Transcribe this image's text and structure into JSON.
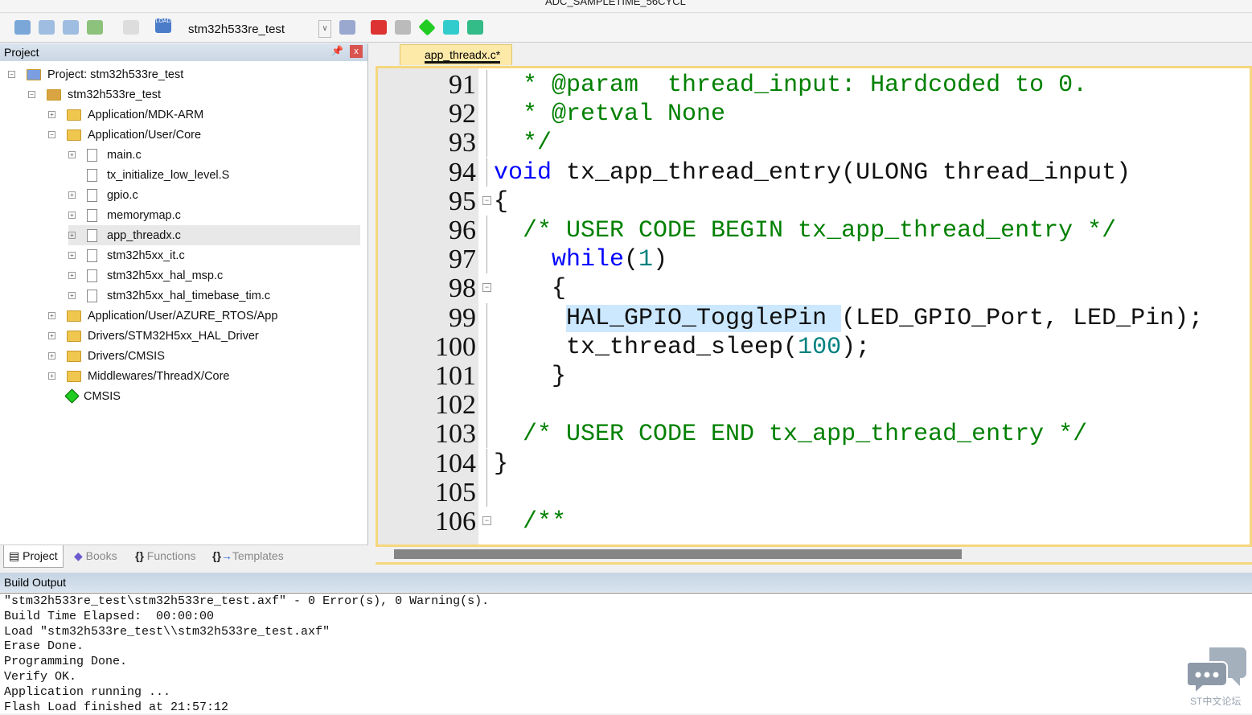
{
  "toolbar": {
    "target": "stm32h533re_test",
    "define_combo": "ADC_SAMPLETIME_56CYCL",
    "load_label": "LOAD"
  },
  "project_panel": {
    "title": "Project",
    "tree": [
      {
        "label": "Project: stm32h533re_test",
        "depth": 0,
        "kind": "project",
        "exp": "-"
      },
      {
        "label": "stm32h533re_test",
        "depth": 1,
        "kind": "target",
        "exp": "-"
      },
      {
        "label": "Application/MDK-ARM",
        "depth": 2,
        "kind": "folder",
        "exp": "+"
      },
      {
        "label": "Application/User/Core",
        "depth": 2,
        "kind": "folder",
        "exp": "-"
      },
      {
        "label": "main.c",
        "depth": 3,
        "kind": "file",
        "exp": "+"
      },
      {
        "label": "tx_initialize_low_level.S",
        "depth": 3,
        "kind": "file",
        "exp": ""
      },
      {
        "label": "gpio.c",
        "depth": 3,
        "kind": "file",
        "exp": "+"
      },
      {
        "label": "memorymap.c",
        "depth": 3,
        "kind": "file",
        "exp": "+"
      },
      {
        "label": "app_threadx.c",
        "depth": 3,
        "kind": "file",
        "exp": "+",
        "selected": true
      },
      {
        "label": "stm32h5xx_it.c",
        "depth": 3,
        "kind": "file",
        "exp": "+"
      },
      {
        "label": "stm32h5xx_hal_msp.c",
        "depth": 3,
        "kind": "file",
        "exp": "+"
      },
      {
        "label": "stm32h5xx_hal_timebase_tim.c",
        "depth": 3,
        "kind": "file",
        "exp": "+"
      },
      {
        "label": "Application/User/AZURE_RTOS/App",
        "depth": 2,
        "kind": "folder",
        "exp": "+"
      },
      {
        "label": "Drivers/STM32H5xx_HAL_Driver",
        "depth": 2,
        "kind": "folder",
        "exp": "+"
      },
      {
        "label": "Drivers/CMSIS",
        "depth": 2,
        "kind": "folder",
        "exp": "+"
      },
      {
        "label": "Middlewares/ThreadX/Core",
        "depth": 2,
        "kind": "folder",
        "exp": "+"
      },
      {
        "label": "CMSIS",
        "depth": 2,
        "kind": "component",
        "exp": ""
      }
    ],
    "tabs": [
      "Project",
      "Books",
      "Functions",
      "Templates"
    ]
  },
  "editor": {
    "tab": "app_threadx.c*",
    "lines": [
      {
        "n": "91",
        "tokens": [
          [
            "  * @param  ",
            "g"
          ],
          [
            "thread_input: Hardcoded to 0.",
            "g"
          ]
        ]
      },
      {
        "n": "92",
        "tokens": [
          [
            "  * @retval None",
            "g"
          ]
        ]
      },
      {
        "n": "93",
        "tokens": [
          [
            "  */",
            "g"
          ]
        ]
      },
      {
        "n": "94",
        "tokens": [
          [
            "void",
            "b"
          ],
          [
            " tx_app_thread_entry(ULONG thread_input)",
            "k"
          ]
        ]
      },
      {
        "n": "95",
        "tokens": [
          [
            "{",
            "k"
          ]
        ]
      },
      {
        "n": "96",
        "tokens": [
          [
            "  /* USER CODE BEGIN tx_app_thread_entry */",
            "g"
          ]
        ]
      },
      {
        "n": "97",
        "tokens": [
          [
            "    ",
            "k"
          ],
          [
            "while",
            "b"
          ],
          [
            "(",
            "k"
          ],
          [
            "1",
            "t"
          ],
          [
            ")",
            "k"
          ]
        ]
      },
      {
        "n": "98",
        "tokens": [
          [
            "    {",
            "k"
          ]
        ]
      },
      {
        "n": "99",
        "tokens": [
          [
            "     ",
            "k"
          ],
          [
            "HAL_GPIO_TogglePin ",
            "h"
          ],
          [
            "(LED_GPIO_Port, LED_Pin);",
            "k"
          ]
        ]
      },
      {
        "n": "100",
        "tokens": [
          [
            "     tx_thread_sleep(",
            "k"
          ],
          [
            "100",
            "t"
          ],
          [
            ");",
            "k"
          ]
        ]
      },
      {
        "n": "101",
        "tokens": [
          [
            "    }",
            "k"
          ]
        ]
      },
      {
        "n": "102",
        "tokens": [
          [
            "",
            "k"
          ]
        ]
      },
      {
        "n": "103",
        "tokens": [
          [
            "  /* USER CODE END tx_app_thread_entry */",
            "g"
          ]
        ]
      },
      {
        "n": "104",
        "tokens": [
          [
            "}",
            "k"
          ]
        ]
      },
      {
        "n": "105",
        "tokens": [
          [
            "",
            "k"
          ]
        ]
      },
      {
        "n": "106",
        "tokens": [
          [
            "  /**",
            "g"
          ]
        ]
      }
    ]
  },
  "build_output": {
    "title": "Build Output",
    "lines": [
      "\"stm32h533re_test\\stm32h533re_test.axf\" - 0 Error(s), 0 Warning(s).",
      "Build Time Elapsed:  00:00:00",
      "Load \"stm32h533re_test\\\\stm32h533re_test.axf\"",
      "Erase Done.",
      "Programming Done.",
      "Verify OK.",
      "Application running ...",
      "Flash Load finished at 21:57:12"
    ]
  },
  "watermark": {
    "text": "ST中文论坛"
  },
  "colors": {
    "comment": "#008000",
    "keyword": "#0000ff",
    "number": "#008080",
    "text": "#111111",
    "highlight": "#cce8ff",
    "tab": "#fde9a8"
  }
}
